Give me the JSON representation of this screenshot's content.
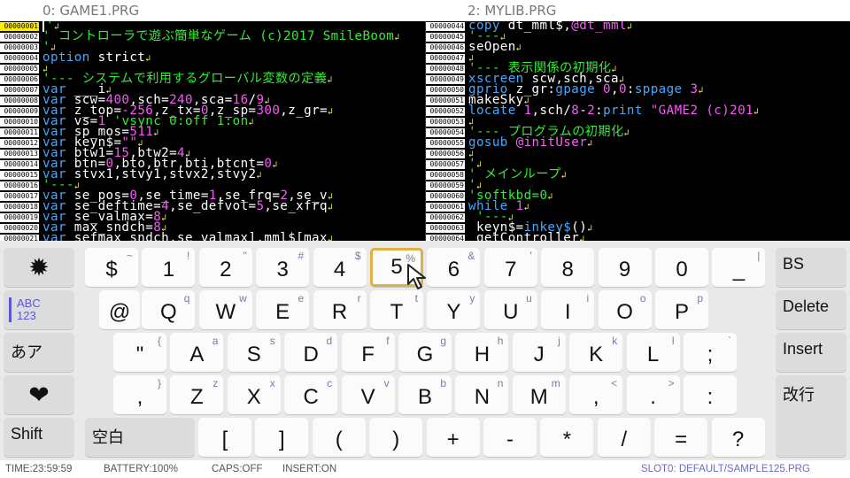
{
  "panes": {
    "left": {
      "title": "0: GAME1.PRG",
      "lines": [
        {
          "no": "00000001",
          "cur": true,
          "segs": [
            {
              "t": "'",
              "c": "g"
            }
          ]
        },
        {
          "no": "00000002",
          "segs": [
            {
              "t": "' コントローラで遊ぶ簡単なゲーム (c)2017 SmileBoom",
              "c": "g"
            }
          ]
        },
        {
          "no": "00000003",
          "segs": [
            {
              "t": "'",
              "c": "g"
            }
          ]
        },
        {
          "no": "00000004",
          "segs": [
            {
              "t": "option",
              "c": "b"
            },
            {
              "t": " strict",
              "c": "w"
            }
          ]
        },
        {
          "no": "00000005",
          "segs": []
        },
        {
          "no": "00000006",
          "segs": [
            {
              "t": "'--- システムで利用するグローバル変数の定義",
              "c": "g"
            }
          ]
        },
        {
          "no": "00000007",
          "segs": [
            {
              "t": "var",
              "c": "b"
            },
            {
              "t": " ___i",
              "c": "w"
            }
          ]
        },
        {
          "no": "00000008",
          "segs": [
            {
              "t": "var",
              "c": "b"
            },
            {
              "t": " scw=",
              "c": "w"
            },
            {
              "t": "400",
              "c": "m"
            },
            {
              "t": ",sch=",
              "c": "w"
            },
            {
              "t": "240",
              "c": "m"
            },
            {
              "t": ",sca=",
              "c": "w"
            },
            {
              "t": "16",
              "c": "m"
            },
            {
              "t": "/",
              "c": "w"
            },
            {
              "t": "9",
              "c": "m"
            }
          ]
        },
        {
          "no": "00000009",
          "segs": [
            {
              "t": "var",
              "c": "b"
            },
            {
              "t": " z_top=",
              "c": "w"
            },
            {
              "t": "-256",
              "c": "m"
            },
            {
              "t": ",z_tx=",
              "c": "w"
            },
            {
              "t": "0",
              "c": "m"
            },
            {
              "t": ",z_sp=",
              "c": "w"
            },
            {
              "t": "300",
              "c": "m"
            },
            {
              "t": ",z_gr=",
              "c": "w"
            }
          ]
        },
        {
          "no": "00000010",
          "segs": [
            {
              "t": "var",
              "c": "b"
            },
            {
              "t": " vs=",
              "c": "w"
            },
            {
              "t": "1",
              "c": "m"
            },
            {
              "t": " 'vsync 0:off 1:on",
              "c": "g"
            }
          ]
        },
        {
          "no": "00000011",
          "segs": [
            {
              "t": "var",
              "c": "b"
            },
            {
              "t": " sp_mos=",
              "c": "w"
            },
            {
              "t": "511",
              "c": "m"
            }
          ]
        },
        {
          "no": "00000012",
          "segs": [
            {
              "t": "var",
              "c": "b"
            },
            {
              "t": " keyn$=",
              "c": "w"
            },
            {
              "t": "\"\"",
              "c": "m"
            }
          ]
        },
        {
          "no": "00000013",
          "segs": [
            {
              "t": "var",
              "c": "b"
            },
            {
              "t": " btw1=",
              "c": "w"
            },
            {
              "t": "15",
              "c": "m"
            },
            {
              "t": ",btw2=",
              "c": "w"
            },
            {
              "t": "4",
              "c": "m"
            }
          ]
        },
        {
          "no": "00000014",
          "segs": [
            {
              "t": "var",
              "c": "b"
            },
            {
              "t": " btn=",
              "c": "w"
            },
            {
              "t": "0",
              "c": "m"
            },
            {
              "t": ",bto,btr,bti,btcnt=",
              "c": "w"
            },
            {
              "t": "0",
              "c": "m"
            }
          ]
        },
        {
          "no": "00000015",
          "segs": [
            {
              "t": "var",
              "c": "b"
            },
            {
              "t": " stvx1,stvy1,stvx2,stvy2",
              "c": "w"
            }
          ]
        },
        {
          "no": "00000016",
          "segs": [
            {
              "t": "'---",
              "c": "g"
            }
          ]
        },
        {
          "no": "00000017",
          "segs": [
            {
              "t": "var",
              "c": "b"
            },
            {
              "t": " se_pos=",
              "c": "w"
            },
            {
              "t": "0",
              "c": "m"
            },
            {
              "t": ",se_time=",
              "c": "w"
            },
            {
              "t": "1",
              "c": "m"
            },
            {
              "t": ",se_frq=",
              "c": "w"
            },
            {
              "t": "2",
              "c": "m"
            },
            {
              "t": ",se_v",
              "c": "w"
            }
          ]
        },
        {
          "no": "00000018",
          "segs": [
            {
              "t": "var",
              "c": "b"
            },
            {
              "t": " se_deftime=",
              "c": "w"
            },
            {
              "t": "4",
              "c": "m"
            },
            {
              "t": ",se_defvol=",
              "c": "w"
            },
            {
              "t": "5",
              "c": "m"
            },
            {
              "t": ",se_xfrq",
              "c": "w"
            }
          ]
        },
        {
          "no": "00000019",
          "segs": [
            {
              "t": "var",
              "c": "b"
            },
            {
              "t": " se_valmax=",
              "c": "w"
            },
            {
              "t": "8",
              "c": "m"
            }
          ]
        },
        {
          "no": "00000020",
          "segs": [
            {
              "t": "var",
              "c": "b"
            },
            {
              "t": " max_sndch=",
              "c": "w"
            },
            {
              "t": "8",
              "c": "m"
            }
          ]
        },
        {
          "no": "00000021",
          "segs": [
            {
              "t": "var",
              "c": "b"
            },
            {
              "t": " sefmax_sndch,se_valmax],mml$[max",
              "c": "w"
            }
          ]
        }
      ]
    },
    "right": {
      "title": "2: MYLIB.PRG",
      "lines": [
        {
          "no": "00000044",
          "segs": [
            {
              "t": "copy",
              "c": "b"
            },
            {
              "t": " dt_mml$,",
              "c": "w"
            },
            {
              "t": "@dt_mml",
              "c": "p"
            }
          ]
        },
        {
          "no": "00000045",
          "segs": [
            {
              "t": "'---",
              "c": "g"
            }
          ]
        },
        {
          "no": "00000046",
          "segs": [
            {
              "t": "seOpen",
              "c": "w"
            }
          ]
        },
        {
          "no": "00000047",
          "segs": []
        },
        {
          "no": "00000048",
          "segs": [
            {
              "t": "'--- 表示関係の初期化",
              "c": "g"
            }
          ]
        },
        {
          "no": "00000049",
          "segs": [
            {
              "t": "xscreen",
              "c": "b"
            },
            {
              "t": " scw,sch,sca",
              "c": "w"
            }
          ]
        },
        {
          "no": "00000050",
          "segs": [
            {
              "t": "gprio",
              "c": "b"
            },
            {
              "t": " z_gr:",
              "c": "w"
            },
            {
              "t": "gpage",
              "c": "b"
            },
            {
              "t": " 0",
              "c": "m"
            },
            {
              "t": ",",
              "c": "w"
            },
            {
              "t": "0",
              "c": "m"
            },
            {
              "t": ":",
              "c": "w"
            },
            {
              "t": "sppage",
              "c": "b"
            },
            {
              "t": " 3",
              "c": "m"
            }
          ]
        },
        {
          "no": "00000051",
          "segs": [
            {
              "t": "makeSky",
              "c": "w"
            }
          ]
        },
        {
          "no": "00000052",
          "segs": [
            {
              "t": "locate",
              "c": "b"
            },
            {
              "t": " 1",
              "c": "m"
            },
            {
              "t": ",sch/",
              "c": "w"
            },
            {
              "t": "8",
              "c": "m"
            },
            {
              "t": "-",
              "c": "w"
            },
            {
              "t": "2",
              "c": "m"
            },
            {
              "t": ":",
              "c": "w"
            },
            {
              "t": "print",
              "c": "b"
            },
            {
              "t": " \"GAME2 (c)201",
              "c": "m"
            }
          ]
        },
        {
          "no": "00000053",
          "segs": []
        },
        {
          "no": "00000054",
          "segs": [
            {
              "t": "'--- プログラムの初期化",
              "c": "g"
            }
          ]
        },
        {
          "no": "00000055",
          "segs": [
            {
              "t": "gosub",
              "c": "b"
            },
            {
              "t": " @initUser",
              "c": "p"
            }
          ]
        },
        {
          "no": "00000056",
          "segs": []
        },
        {
          "no": "00000057",
          "segs": [
            {
              "t": "'",
              "c": "g"
            }
          ]
        },
        {
          "no": "00000058",
          "segs": [
            {
              "t": "' メインループ",
              "c": "g"
            }
          ]
        },
        {
          "no": "00000059",
          "segs": [
            {
              "t": "'",
              "c": "g"
            }
          ]
        },
        {
          "no": "00000060",
          "segs": [
            {
              "t": "'softkbd=0",
              "c": "g"
            }
          ]
        },
        {
          "no": "00000061",
          "segs": [
            {
              "t": "while",
              "c": "b"
            },
            {
              "t": " 1",
              "c": "m"
            }
          ]
        },
        {
          "no": "00000062",
          "segs": [
            {
              "t": " '---",
              "c": "g"
            }
          ]
        },
        {
          "no": "00000063",
          "segs": [
            {
              "t": " keyn$=",
              "c": "w"
            },
            {
              "t": "inkey$",
              "c": "b"
            },
            {
              "t": "()",
              "c": "w"
            }
          ]
        },
        {
          "no": "00000064",
          "segs": [
            {
              "t": " getController",
              "c": "w"
            }
          ]
        }
      ]
    }
  },
  "keyboard": {
    "side_left": [
      {
        "name": "settings-key",
        "icon": "✹",
        "label": ""
      },
      {
        "name": "abc-mode-key",
        "label": "ABC\n123",
        "abc": true
      },
      {
        "name": "kana-mode-key",
        "label": "あア"
      },
      {
        "name": "symbol-mode-key",
        "icon": "❤",
        "label": ""
      },
      {
        "name": "shift-key",
        "label": "Shift"
      }
    ],
    "side_right": [
      {
        "name": "bs-key",
        "label": "BS"
      },
      {
        "name": "delete-key",
        "label": "Delete"
      },
      {
        "name": "insert-key",
        "label": "Insert"
      },
      {
        "name": "newline-key",
        "label": "改行"
      }
    ],
    "space_label": "空白",
    "rows": [
      [
        [
          "$",
          "~"
        ],
        [
          "1",
          "!"
        ],
        [
          "2",
          "\""
        ],
        [
          "3",
          "#"
        ],
        [
          "4",
          "$"
        ],
        [
          "5",
          "%"
        ],
        [
          "6",
          "&"
        ],
        [
          "7",
          "'"
        ],
        [
          "8",
          ""
        ],
        [
          "9",
          ""
        ],
        [
          "0",
          ""
        ],
        [
          "_",
          "|"
        ]
      ],
      [
        [
          "@",
          ""
        ],
        [
          "Q",
          "q"
        ],
        [
          "W",
          "w"
        ],
        [
          "E",
          "e"
        ],
        [
          "R",
          "r"
        ],
        [
          "T",
          "t"
        ],
        [
          "Y",
          "y"
        ],
        [
          "U",
          "u"
        ],
        [
          "I",
          "i"
        ],
        [
          "O",
          "o"
        ],
        [
          "P",
          "p"
        ]
      ],
      [
        [
          "\"",
          "{"
        ],
        [
          "A",
          "a"
        ],
        [
          "S",
          "s"
        ],
        [
          "D",
          "d"
        ],
        [
          "F",
          "f"
        ],
        [
          "G",
          "g"
        ],
        [
          "H",
          "h"
        ],
        [
          "J",
          "j"
        ],
        [
          "K",
          "k"
        ],
        [
          "L",
          "l"
        ],
        [
          ";",
          "`"
        ]
      ],
      [
        [
          ",",
          "}"
        ],
        [
          "Z",
          "z"
        ],
        [
          "X",
          "x"
        ],
        [
          "C",
          "c"
        ],
        [
          "V",
          "v"
        ],
        [
          "B",
          "b"
        ],
        [
          "N",
          "n"
        ],
        [
          "M",
          "m"
        ],
        [
          ",",
          "<"
        ],
        [
          ".",
          ">"
        ],
        [
          ":",
          ""
        ]
      ],
      [
        [
          "[",
          ""
        ],
        [
          "]",
          ""
        ],
        [
          "(",
          ""
        ],
        [
          ")",
          ""
        ],
        [
          "+",
          ""
        ],
        [
          "-",
          ""
        ],
        [
          "*",
          ""
        ],
        [
          "/",
          ""
        ],
        [
          "=",
          ""
        ],
        [
          "?",
          ""
        ]
      ]
    ],
    "highlighted": "5"
  },
  "status": {
    "time": "TIME:23:59:59",
    "battery": "BATTERY:100%",
    "caps": "CAPS:OFF",
    "insert": "INSERT:ON",
    "slot": "SLOT0: DEFAULT/SAMPLE125.PRG"
  }
}
